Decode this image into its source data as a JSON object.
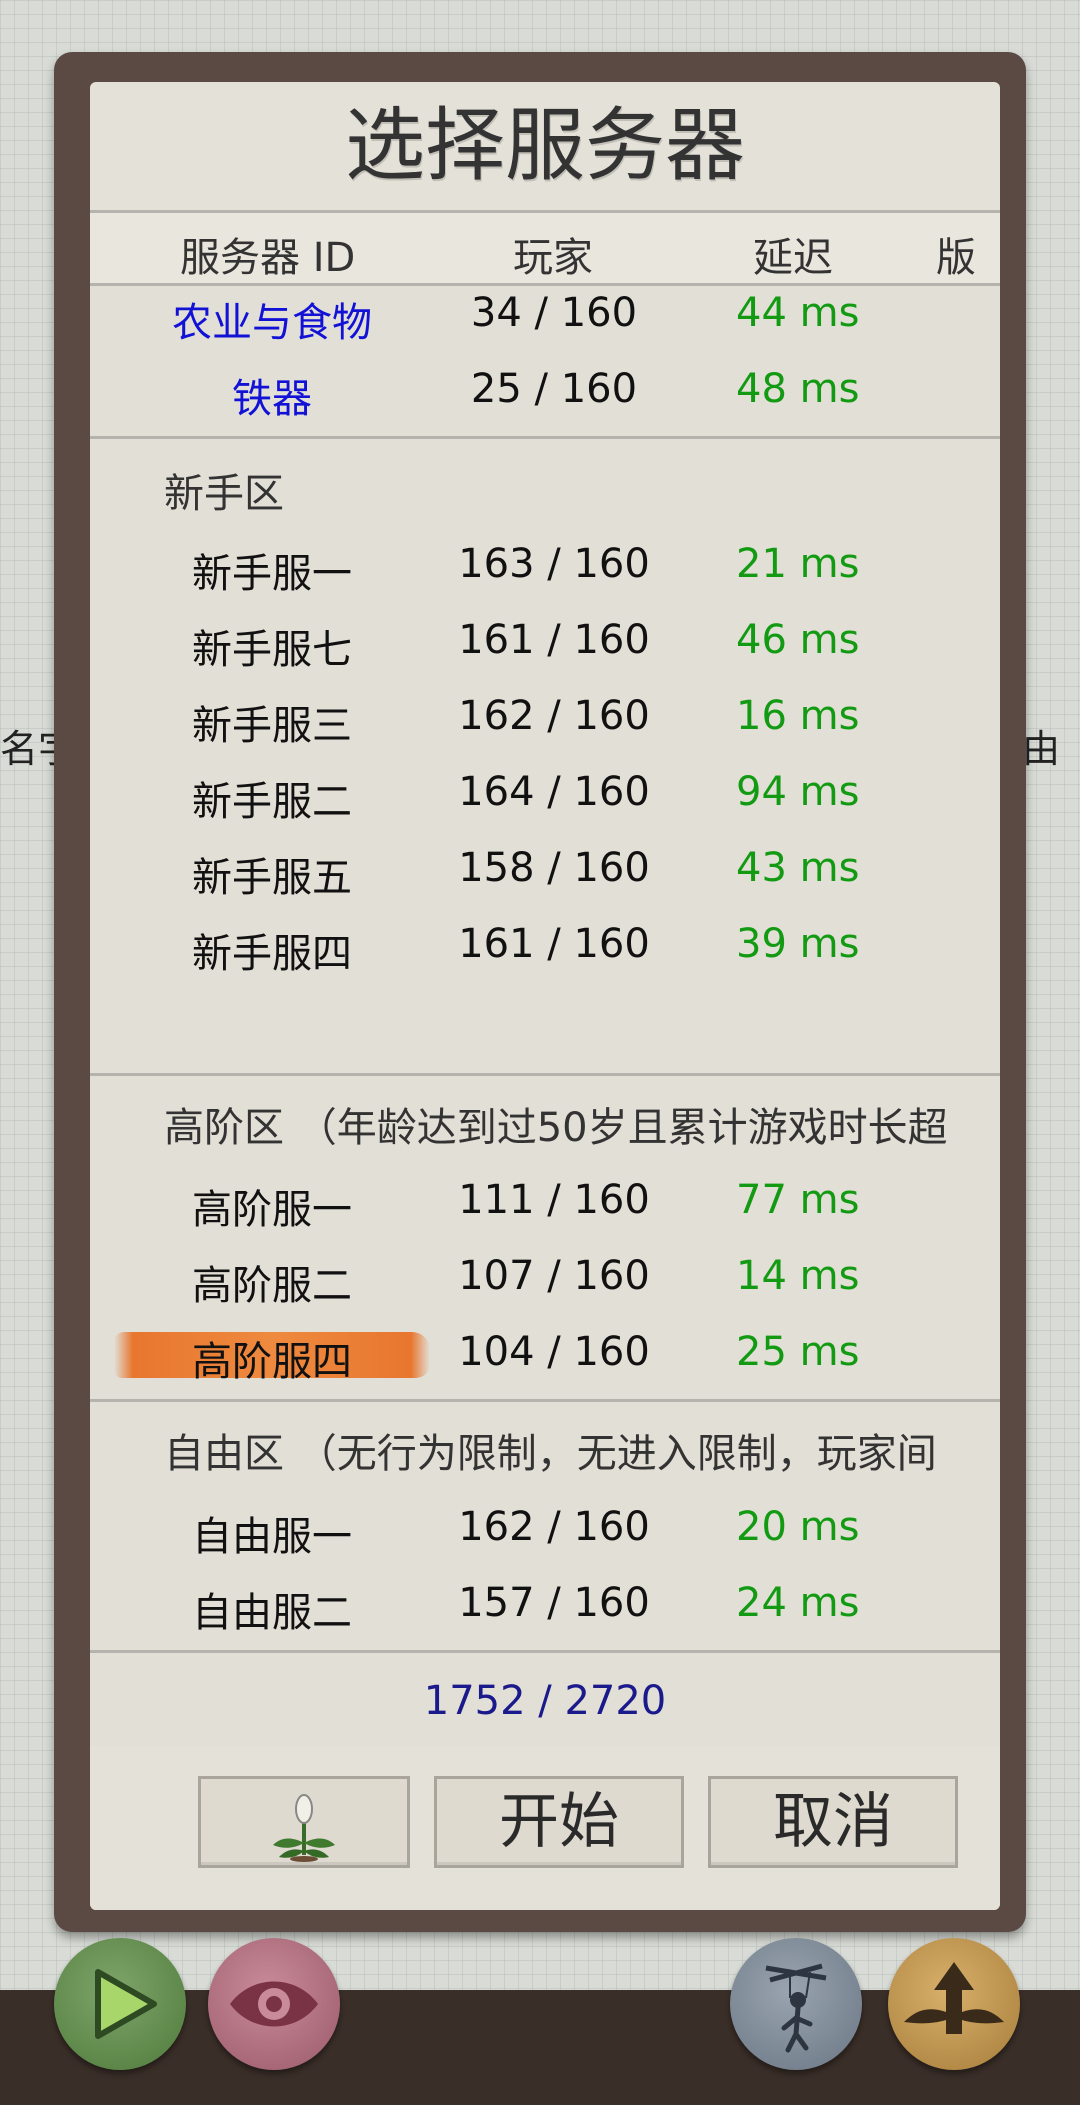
{
  "side_left_text": "名字",
  "side_right_text": "由",
  "dialog": {
    "title": "选择服务器",
    "columns": [
      "服务器 ID",
      "玩家",
      "延迟",
      "版本"
    ],
    "top_rows": [
      {
        "name": "农业与食物",
        "players": "34 / 160",
        "ping": "44 ms"
      },
      {
        "name": "铁器",
        "players": "25 / 160",
        "ping": "48 ms"
      }
    ],
    "sections": [
      {
        "title": "新手区",
        "rows": [
          {
            "name": "新手服一",
            "players": "163 / 160",
            "ping": "21 ms"
          },
          {
            "name": "新手服七",
            "players": "161 / 160",
            "ping": "46 ms"
          },
          {
            "name": "新手服三",
            "players": "162 / 160",
            "ping": "16 ms"
          },
          {
            "name": "新手服二",
            "players": "164 / 160",
            "ping": "94 ms"
          },
          {
            "name": "新手服五",
            "players": "158 / 160",
            "ping": "43 ms"
          },
          {
            "name": "新手服四",
            "players": "161 / 160",
            "ping": "39 ms"
          }
        ]
      },
      {
        "title": "高阶区 （年龄达到过50岁且累计游戏时长超",
        "rows": [
          {
            "name": "高阶服一",
            "players": "111 / 160",
            "ping": "77 ms"
          },
          {
            "name": "高阶服二",
            "players": "107 / 160",
            "ping": "14 ms"
          },
          {
            "name": "高阶服四",
            "players": "104 / 160",
            "ping": "25 ms",
            "selected": true
          }
        ]
      },
      {
        "title": "自由区 （无行为限制，无进入限制，玩家间",
        "rows": [
          {
            "name": "自由服一",
            "players": "162 / 160",
            "ping": "20 ms"
          },
          {
            "name": "自由服二",
            "players": "157 / 160",
            "ping": "24 ms"
          }
        ]
      }
    ],
    "total": "1752 / 2720",
    "buttons": {
      "start": "开始",
      "cancel": "取消",
      "plant_icon": "plant-icon"
    }
  },
  "bottom_buttons": [
    "play-icon",
    "eye-icon",
    "puppet-icon",
    "wings-arrow-icon"
  ],
  "colors": {
    "link": "#1212d6",
    "ping": "#139a13",
    "total": "#1a1a8c",
    "selected": "#ee8a3f"
  }
}
